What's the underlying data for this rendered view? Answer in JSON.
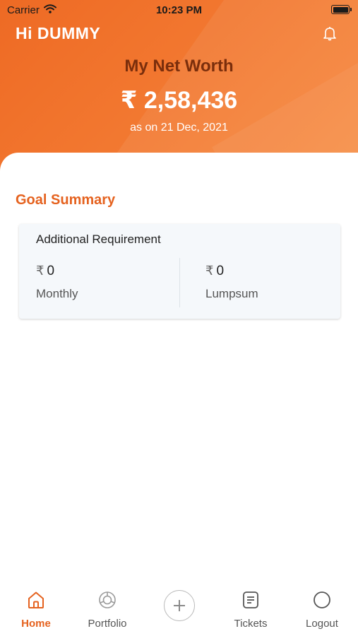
{
  "status_bar": {
    "carrier": "Carrier",
    "time": "10:23 PM"
  },
  "header": {
    "greeting": "Hi DUMMY",
    "networth_title": "My Net Worth",
    "networth_value": "₹ 2,58,436",
    "networth_date": "as on 21 Dec, 2021"
  },
  "goal_summary": {
    "title": "Goal Summary",
    "card_title": "Additional Requirement",
    "currency_symbol": "₹",
    "monthly_value": "0",
    "monthly_label": "Monthly",
    "lumpsum_value": "0",
    "lumpsum_label": "Lumpsum"
  },
  "tabbar": {
    "home": "Home",
    "portfolio": "Portfolio",
    "tickets": "Tickets",
    "logout": "Logout"
  },
  "colors": {
    "brand_orange": "#ee6a24",
    "section_title": "#e5621f",
    "networth_title": "#7a2e0c"
  },
  "icons": {
    "status": [
      "wifi-icon",
      "battery-icon"
    ],
    "header": "bell-icon",
    "tabs": [
      "home-icon",
      "portfolio-icon",
      "plus-icon",
      "tickets-icon",
      "logout-icon"
    ]
  }
}
